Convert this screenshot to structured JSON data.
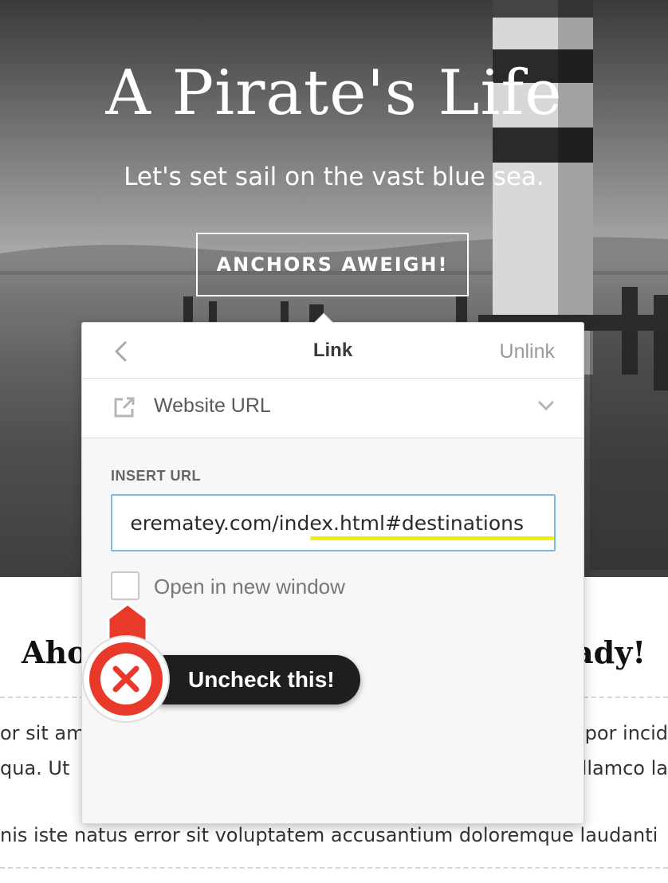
{
  "hero": {
    "title": "A Pirate's Life",
    "subtitle": "Let's set sail on the vast blue sea.",
    "button_label": "ANCHORS AWEIGH!"
  },
  "content": {
    "heading_left": "Aho",
    "heading_right": "ady!",
    "lines": [
      "or sit am",
      "por incid",
      "qua.  Ut",
      "llamco la",
      "nis iste natus error sit voluptatem accusantium doloremque laudanti"
    ]
  },
  "link_popover": {
    "back_icon": "chevron-left-icon",
    "title": "Link",
    "unlink_label": "Unlink",
    "link_type_icon": "external-link-icon",
    "link_type": "Website URL",
    "dropdown_icon": "chevron-down-icon",
    "url_label": "INSERT URL",
    "url_value": "erematey.com/index.html#destinations",
    "checkbox_label": "Open in new window",
    "checkbox_checked": false
  },
  "annotation": {
    "icon": "close-x-icon",
    "text": "Uncheck this!",
    "colors": {
      "marker": "#e8392a",
      "pill": "#1e1e1e",
      "highlight": "#f4ef00"
    }
  }
}
